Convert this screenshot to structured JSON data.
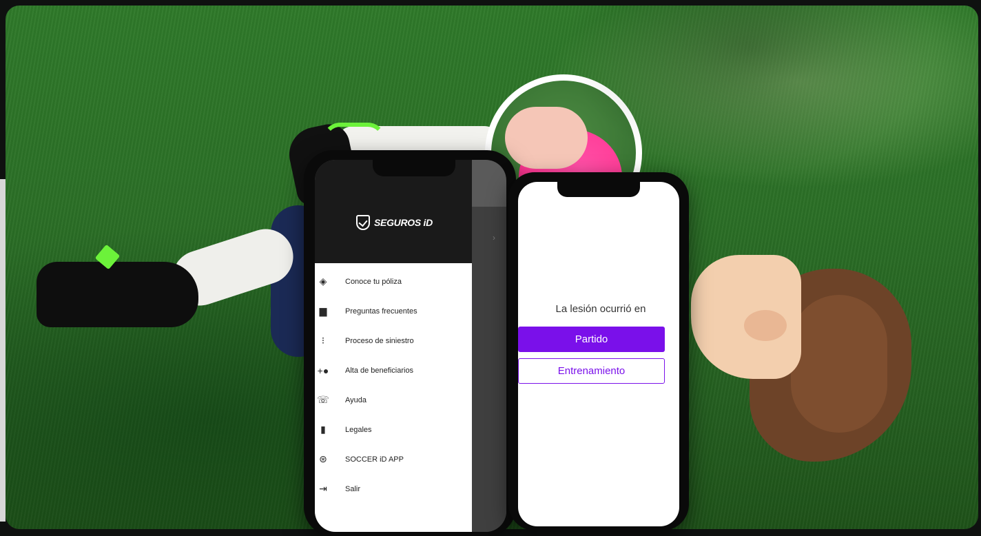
{
  "brand": {
    "name": "SEGUROS iD"
  },
  "menu": {
    "items": [
      {
        "icon": "shield-icon",
        "label": "Conoce tu póliza"
      },
      {
        "icon": "chat-icon",
        "label": "Preguntas frecuentes"
      },
      {
        "icon": "flow-icon",
        "label": "Proceso de siniestro"
      },
      {
        "icon": "add-person-icon",
        "label": "Alta de beneficiarios"
      },
      {
        "icon": "phone-icon",
        "label": "Ayuda"
      },
      {
        "icon": "book-icon",
        "label": "Legales"
      },
      {
        "icon": "soccer-ball-icon",
        "label": "SOCCER iD APP"
      },
      {
        "icon": "exit-icon",
        "label": "Salir"
      }
    ]
  },
  "injury": {
    "question": "La lesión ocurrió en",
    "option_primary": "Partido",
    "option_secondary": "Entrenamiento"
  },
  "colors": {
    "accent": "#7a10ea",
    "menu_header": "#1a1a1a"
  }
}
